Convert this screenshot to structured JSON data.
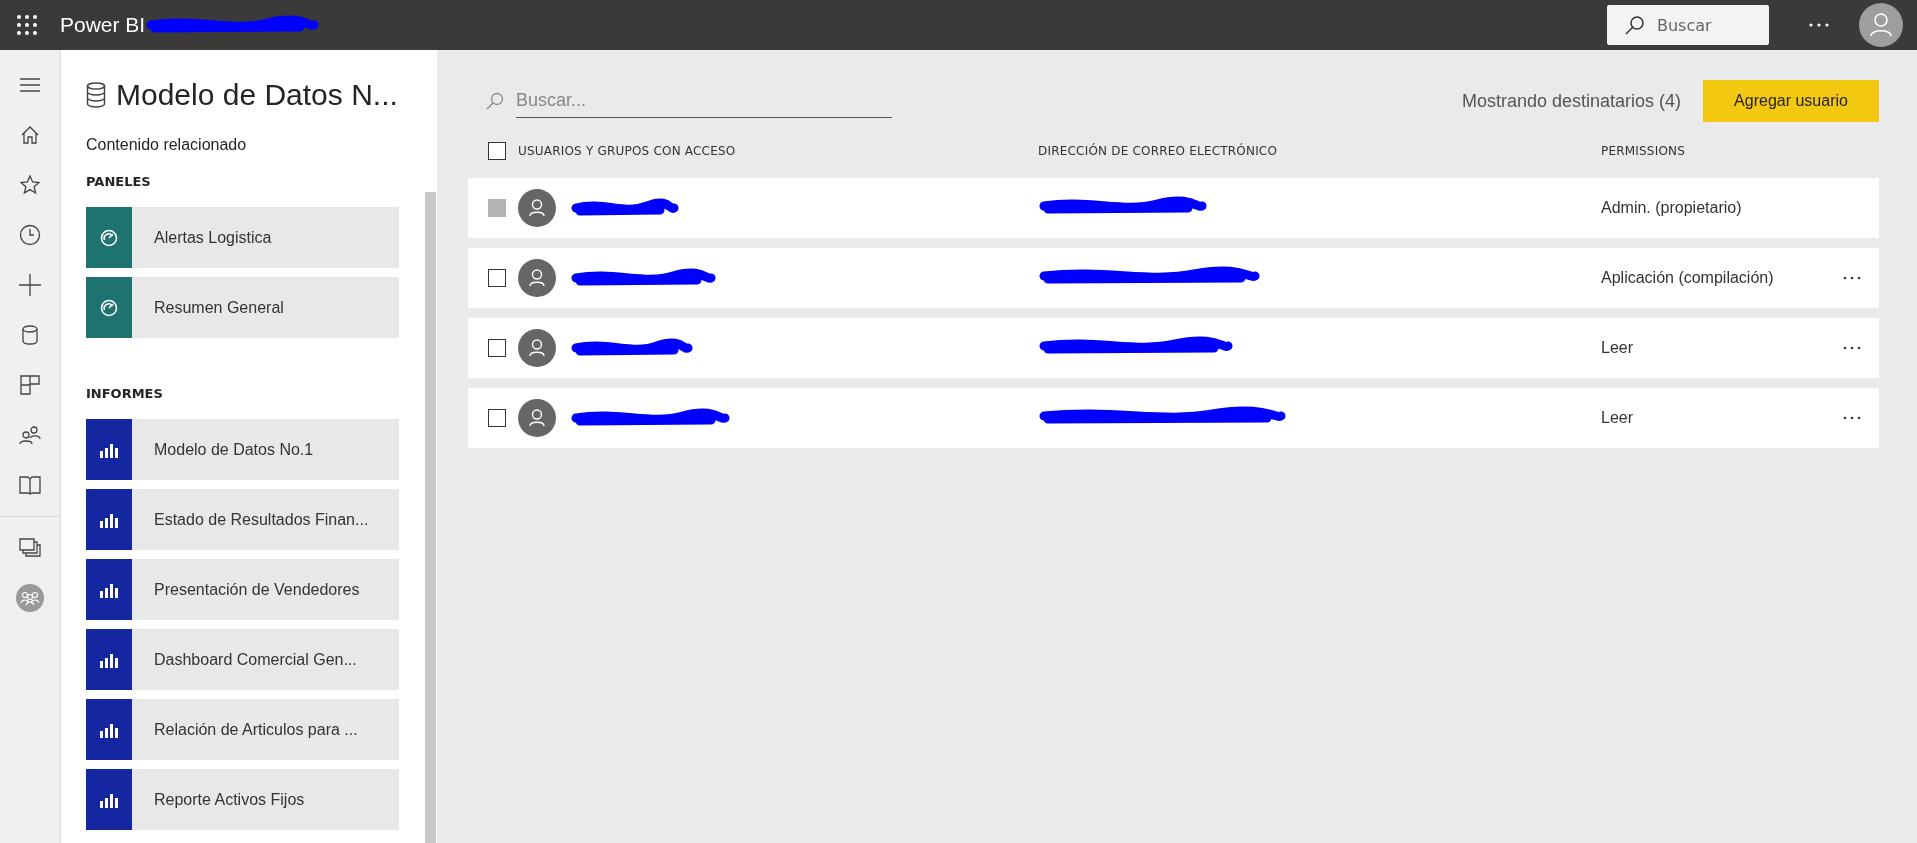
{
  "app": {
    "title": "Power BI"
  },
  "top_search": {
    "placeholder": "Buscar"
  },
  "panel": {
    "title": "Modelo de Datos N...",
    "subtitle": "Contenido relacionado",
    "sections": [
      {
        "heading": "PANELES",
        "kind": "dashboard",
        "items": [
          "Alertas Logistica",
          "Resumen General"
        ]
      },
      {
        "heading": "INFORMES",
        "kind": "report",
        "items": [
          "Modelo de Datos No.1",
          "Estado de Resultados Finan...",
          "Presentación de Vendedores",
          "Dashboard Comercial Gen...",
          "Relación de Articulos para ...",
          "Reporte Activos Fijos"
        ]
      }
    ]
  },
  "search": {
    "placeholder": "Buscar..."
  },
  "summary": "Mostrando destinatarios (4)",
  "add_button": "Agregar usuario",
  "table": {
    "columns": [
      "USUARIOS Y GRUPOS CON ACCESO",
      "DIRECCIÓN DE CORREO ELECTRÓNICO",
      "PERMISSIONS"
    ],
    "select_all": {
      "checked": false
    },
    "rows": [
      {
        "permission": "Admin. (propietario)",
        "checked": false,
        "disabled": true,
        "has_menu": false
      },
      {
        "permission": "Aplicación (compilación)",
        "checked": false,
        "disabled": false,
        "has_menu": true
      },
      {
        "permission": "Leer",
        "checked": false,
        "disabled": false,
        "has_menu": true
      },
      {
        "permission": "Leer",
        "checked": false,
        "disabled": false,
        "has_menu": true
      }
    ]
  }
}
